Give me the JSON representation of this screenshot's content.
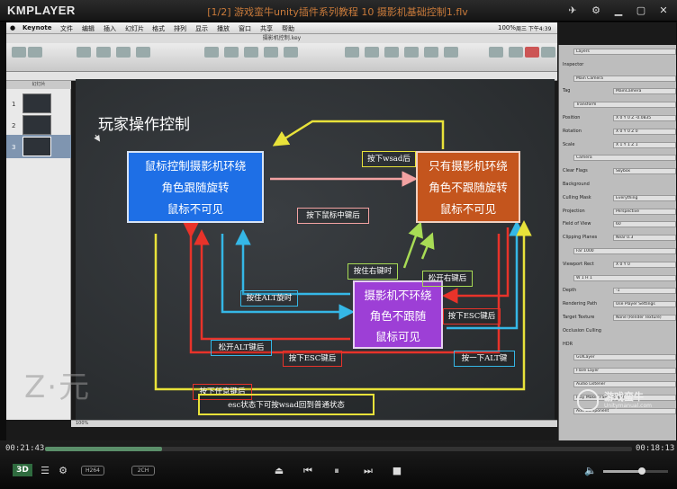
{
  "player": {
    "logo": "KMPLAYER",
    "title": "[1/2] 游戏蛮牛unity插件系列教程 10 摄影机基础控制1.flv",
    "elapsed": "00:21:43",
    "total": "00:18:13",
    "progress": 0.2,
    "volume": 0.6,
    "badges": {
      "codec": "H264",
      "channels": "2CH",
      "mode": "3D"
    }
  },
  "keynote": {
    "menu": [
      "Keynote",
      "文件",
      "编辑",
      "插入",
      "幻灯片",
      "格式",
      "排列",
      "显示",
      "播放",
      "窗口",
      "共享",
      "帮助"
    ],
    "clock": "周三 下午4:39",
    "battery": "100%",
    "doc_title": "摄影机控制.key",
    "navigator_label": "幻灯片",
    "slide_numbers": [
      "1",
      "2",
      "3"
    ],
    "zoom": "100%"
  },
  "slide": {
    "title": "玩家操作控制",
    "box_left": [
      "鼠标控制摄影机环绕",
      "角色跟随旋转",
      "鼠标不可见"
    ],
    "box_right": [
      "只有摄影机环绕",
      "角色不跟随旋转",
      "鼠标不可见"
    ],
    "box_center": [
      "摄影机不环绕",
      "角色不跟随",
      "鼠标可见"
    ],
    "labels": {
      "press_wsad": "按下wsad后",
      "press_middle": "按下鼠标中键后",
      "hold_right": "按住右键时",
      "release_right": "松开右键后",
      "hold_alt": "按住ALT旋时",
      "press_esc_r": "按下ESC键后",
      "release_alt": "松开ALT键后",
      "press_esc_c": "按下ESC键后",
      "press_alt_once": "按一下ALT键",
      "press_any": "按下任意键后",
      "footer": "esc状态下可按wsad回到普通状态"
    }
  },
  "overlay": {
    "watermark": "Z·元",
    "brand": "游戏蛮牛",
    "brand_url": "Unitymanual.com"
  },
  "unity": {
    "rows": [
      [
        "",
        "Layers"
      ],
      [
        "Inspector",
        ""
      ],
      [
        "",
        "Main Camera"
      ],
      [
        "Tag",
        "MainCamera"
      ],
      [
        "",
        "Transform"
      ],
      [
        "Position",
        "X 0  Y 0  Z -0.0835"
      ],
      [
        "Rotation",
        "X 0  Y 0  Z 0"
      ],
      [
        "Scale",
        "X 1  Y 1  Z 1"
      ],
      [
        "",
        "Camera"
      ],
      [
        "Clear Flags",
        "Skybox"
      ],
      [
        "Background",
        ""
      ],
      [
        "Culling Mask",
        "Everything"
      ],
      [
        "Projection",
        "Perspective"
      ],
      [
        "Field of View",
        "60"
      ],
      [
        "Clipping Planes",
        "Near 0.3"
      ],
      [
        "",
        "Far 1000"
      ],
      [
        "Viewport Rect",
        "X 0  Y 0"
      ],
      [
        "",
        "W 1  H 1"
      ],
      [
        "Depth",
        "-1"
      ],
      [
        "Rendering Path",
        "Use Player Settings"
      ],
      [
        "Target Texture",
        "None (Render Texture)"
      ],
      [
        "Occlusion Culling",
        ""
      ],
      [
        "HDR",
        ""
      ],
      [
        "",
        "GUILayer"
      ],
      [
        "",
        "Flare Layer"
      ],
      [
        "",
        "Audio Listener"
      ],
      [
        "",
        "Play Maker FSM (Script)"
      ],
      [
        "",
        "Add Component"
      ]
    ]
  }
}
